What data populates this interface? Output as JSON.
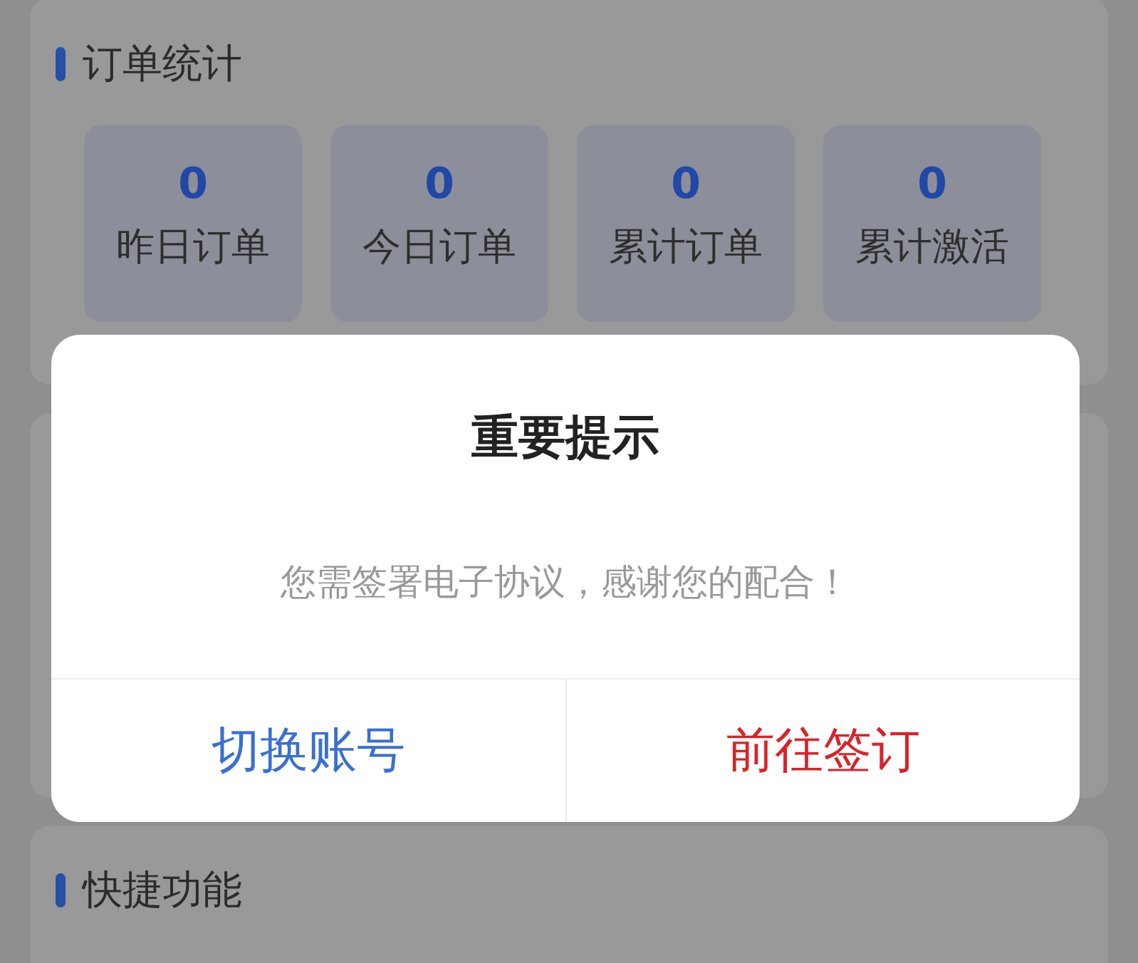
{
  "order_stats": {
    "title": "订单统计",
    "tiles": [
      {
        "value": "0",
        "label": "昨日订单"
      },
      {
        "value": "0",
        "label": "今日订单"
      },
      {
        "value": "0",
        "label": "累计订单"
      },
      {
        "value": "0",
        "label": "累计激活"
      }
    ]
  },
  "quick_functions": {
    "title": "快捷功能"
  },
  "dialog": {
    "title": "重要提示",
    "message": "您需签署电子协议，感谢您的配合！",
    "buttons": [
      {
        "label": "切换账号",
        "kind": "secondary"
      },
      {
        "label": "前往签订",
        "kind": "primary"
      }
    ]
  }
}
